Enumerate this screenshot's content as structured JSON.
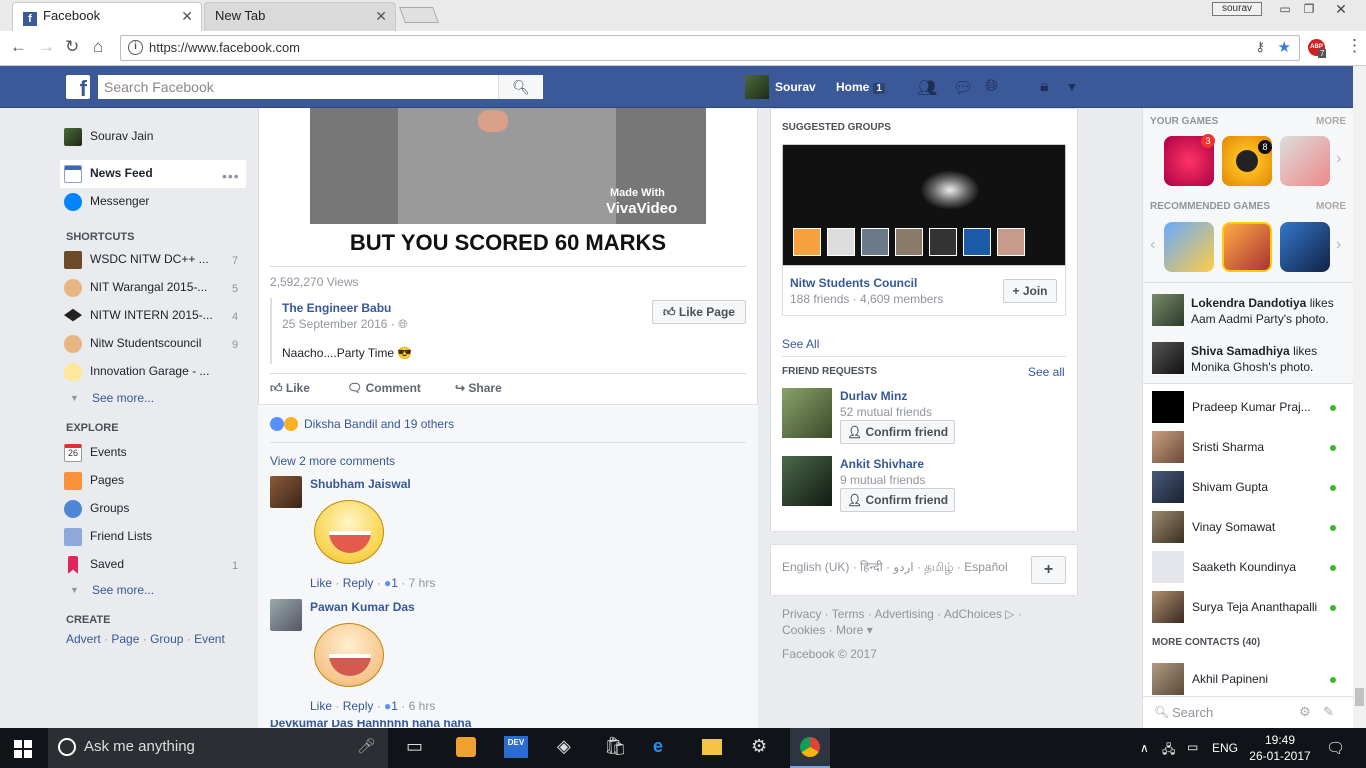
{
  "browser": {
    "tabs": [
      {
        "label": "Facebook"
      },
      {
        "label": "New Tab"
      }
    ],
    "user_chip": "sourav",
    "url": "https://www.facebook.com",
    "abp_badge": "ABP",
    "abp_count": "7"
  },
  "header": {
    "logo": "f",
    "search_placeholder": "Search Facebook",
    "user_name": "Sourav",
    "home_label": "Home",
    "home_count": "1"
  },
  "left_nav": {
    "profile_name": "Sourav Jain",
    "news_feed": "News Feed",
    "messenger": "Messenger",
    "shortcuts_title": "SHORTCUTS",
    "shortcuts": [
      {
        "label": "WSDC NITW DC++ ...",
        "count": "7"
      },
      {
        "label": "NIT Warangal 2015-...",
        "count": "5"
      },
      {
        "label": "NITW INTERN 2015-...",
        "count": "4"
      },
      {
        "label": "Nitw Studentscouncil",
        "count": "9"
      },
      {
        "label": "Innovation Garage - ...",
        "count": ""
      }
    ],
    "see_more": "See more...",
    "explore_title": "EXPLORE",
    "explore": [
      {
        "label": "Events",
        "count": ""
      },
      {
        "label": "Pages",
        "count": ""
      },
      {
        "label": "Groups",
        "count": ""
      },
      {
        "label": "Friend Lists",
        "count": ""
      },
      {
        "label": "Saved",
        "count": "1"
      }
    ],
    "events_date": "26",
    "see_more2": "See more...",
    "create_title": "CREATE",
    "create_links": [
      "Advert",
      "Page",
      "Group",
      "Event"
    ]
  },
  "post": {
    "video_watermark_1": "Made With",
    "video_watermark_2": "VivaVideo",
    "meme_text": "BUT YOU SCORED 60 MARKS",
    "views": "2,592,270 Views",
    "page_name": "The Engineer Babu",
    "date": "25 September 2016",
    "caption": "Naacho....Party Time 😎",
    "like_page": "Like Page",
    "like": "Like",
    "comment": "Comment",
    "share": "Share",
    "reactions": "Diksha Bandil and 19 others",
    "view_more": "View 2 more comments",
    "comments": [
      {
        "name": "Shubham Jaiswal",
        "like": "Like",
        "reply": "Reply",
        "likes": "1",
        "time": "7 hrs"
      },
      {
        "name": "Pawan Kumar Das",
        "like": "Like",
        "reply": "Reply",
        "likes": "1",
        "time": "6 hrs"
      }
    ],
    "next_comment_partial": "Devkumar Das  Hahhhhh haha haha"
  },
  "right": {
    "suggested_groups": "SUGGESTED GROUPS",
    "group_name": "Nitw Students Council",
    "group_meta": "188 friends · 4,609 members",
    "join": "Join",
    "see_all": "See All",
    "friend_requests": "FRIEND REQUESTS",
    "see_all2": "See all",
    "requests": [
      {
        "name": "Durlav Minz",
        "mutual": "52 mutual friends",
        "btn": "Confirm friend"
      },
      {
        "name": "Ankit Shivhare",
        "mutual": "9 mutual friends",
        "btn": "Confirm friend"
      }
    ],
    "languages": "English (UK) · हिन्दी · اردو · தமிழ் · Español",
    "footer1": "Privacy · Terms · Advertising · AdChoices ▷ ·",
    "footer2": "Cookies · More ▾",
    "copyright": "Facebook © 2017"
  },
  "chat": {
    "your_games": "YOUR GAMES",
    "more": "MORE",
    "game_badge_1": "3",
    "game_badge_2": "8",
    "recommended_games": "RECOMMENDED GAMES",
    "more2": "MORE",
    "ticker": [
      {
        "name": "Lokendra Dandotiya",
        "action": "likes",
        "object": "Aam Aadmi Party's photo."
      },
      {
        "name": "Shiva Samadhiya",
        "action": "likes",
        "object": "Monika Ghosh's photo."
      }
    ],
    "contacts": [
      "Pradeep Kumar Praj...",
      "Sristi Sharma",
      "Shivam Gupta",
      "Vinay Somawat",
      "Saaketh Koundinya",
      "Surya Teja Ananthapalli"
    ],
    "more_contacts": "MORE CONTACTS (40)",
    "more_contact_1": "Akhil Papineni",
    "search_placeholder": "Search"
  },
  "taskbar": {
    "cortana": "Ask me anything",
    "lang": "ENG",
    "time": "19:49",
    "date": "26-01-2017",
    "dev_label": "DEV"
  }
}
